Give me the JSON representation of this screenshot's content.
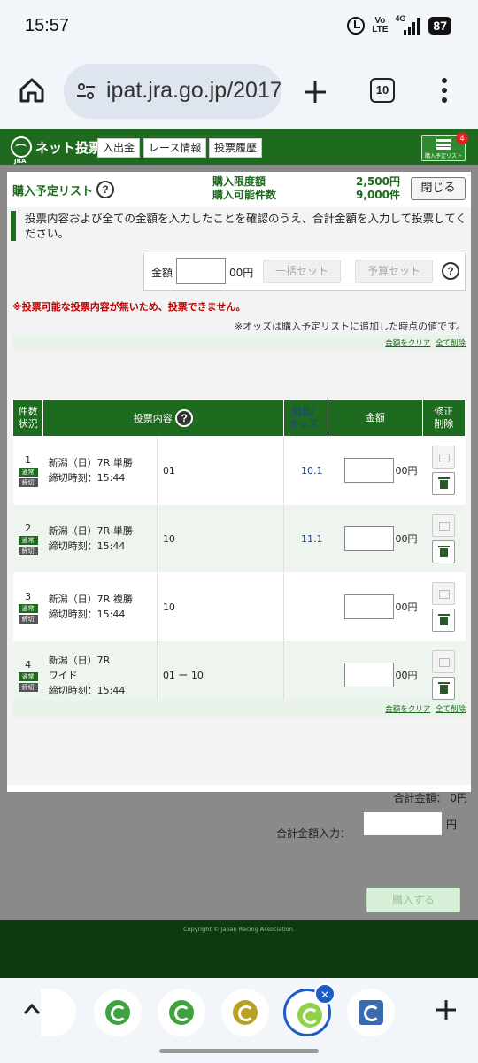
{
  "status": {
    "time": "15:57",
    "volte": "Vo\nLTE",
    "network": "4G",
    "battery": "87"
  },
  "browser": {
    "url": "ipat.jra.go.jp/2017",
    "tab_count": "10"
  },
  "header": {
    "logo_text": "ネット投票",
    "logo_sub": "JRA",
    "nav": [
      "入出金",
      "レース情報",
      "投票履歴"
    ],
    "cart_label": "購入予定リスト",
    "cart_badge": "4"
  },
  "panel": {
    "title": "購入予定リスト",
    "limit_label": "購入限度額",
    "limit_value": "2,500円",
    "count_label": "購入可能件数",
    "count_value": "9,000件",
    "close_button": "閉じる",
    "notice": "投票内容および全ての金額を入力したことを確認のうえ、合計金額を入力して投票してください。",
    "amount_label": "金額",
    "amount_unit": "00円",
    "bulk_set": "一括セット",
    "budget_set": "予算セット",
    "warning": "※投票可能な投票内容が無いため、投票できません。",
    "odds_note": "※オッズは購入予定リストに追加した時点の値です。",
    "clear_amount": "金額をクリア",
    "delete_all": "全て削除"
  },
  "table": {
    "headers": {
      "no": "件数\n状況",
      "content": "投票内容",
      "odds": "組数/\nオッズ",
      "amount": "金額",
      "edit": "修正\n削除"
    },
    "tag_normal": "通常",
    "tag_closed": "締切",
    "yen_unit": "00円",
    "rows": [
      {
        "no": "1",
        "race": "新潟（日）7R 単勝",
        "deadline": "締切時刻：15:44",
        "selection": "01",
        "odds": "10.1"
      },
      {
        "no": "2",
        "race": "新潟（日）7R 単勝",
        "deadline": "締切時刻：15:44",
        "selection": "10",
        "odds": "11.1"
      },
      {
        "no": "3",
        "race": "新潟（日）7R 複勝",
        "deadline": "締切時刻：15:44",
        "selection": "10",
        "odds": ""
      },
      {
        "no": "4",
        "race": "新潟（日）7R\nワイド",
        "deadline": "締切時刻：15:44",
        "selection": "01 ー 10",
        "odds": ""
      }
    ]
  },
  "summary": {
    "total": "合計金額： 0円",
    "total_input_label": "合計金額入力：",
    "total_input_unit": "円",
    "buy_button": "購入する"
  },
  "footer": {
    "copyright": "Copyright © Japan Racing Association."
  },
  "colors": {
    "jra_green": "#1e6a1e",
    "warning_red": "#c00000",
    "odds_blue": "#1f3f8f",
    "tab_active": "#1d5cc4"
  }
}
